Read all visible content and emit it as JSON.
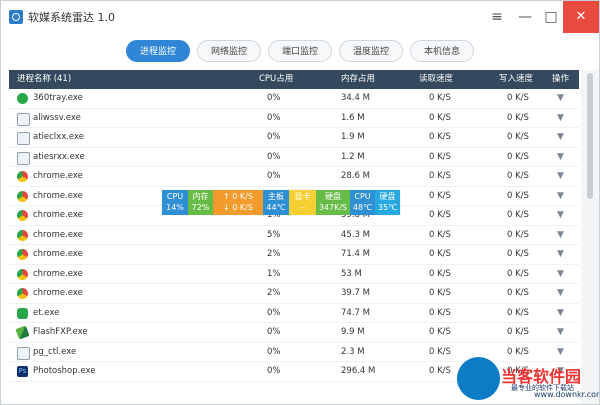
{
  "window": {
    "title": "软媒系统雷达 1.0"
  },
  "controls": {
    "menu": "≡",
    "minimize": "—",
    "maximize": "□",
    "close": "✕"
  },
  "tabs": [
    "进程监控",
    "网络监控",
    "端口监控",
    "温度监控",
    "本机信息"
  ],
  "header": {
    "name": "进程名称 (41)",
    "cpu": "CPU占用",
    "mem": "内存占用",
    "read": "读取速度",
    "write": "写入速度",
    "action": "操作"
  },
  "rows": [
    {
      "name": "360tray.exe",
      "cpu": "0%",
      "mem": "34.4 M",
      "read": "0 K/S",
      "write": "0 K/S",
      "icon": "360-icon"
    },
    {
      "name": "aliwssv.exe",
      "cpu": "0%",
      "mem": "1.6 M",
      "read": "0 K/S",
      "write": "0 K/S",
      "icon": "window-icon"
    },
    {
      "name": "atieclxx.exe",
      "cpu": "0%",
      "mem": "1.9 M",
      "read": "0 K/S",
      "write": "0 K/S",
      "icon": "window-icon"
    },
    {
      "name": "atiesrxx.exe",
      "cpu": "0%",
      "mem": "1.2 M",
      "read": "0 K/S",
      "write": "0 K/S",
      "icon": "window-icon"
    },
    {
      "name": "chrome.exe",
      "cpu": "0%",
      "mem": "28.6 M",
      "read": "0 K/S",
      "write": "0 K/S",
      "icon": "chrome-icon"
    },
    {
      "name": "chrome.exe",
      "cpu": "",
      "mem": "",
      "read": "0 K/S",
      "write": "0 K/S",
      "icon": "chrome-icon"
    },
    {
      "name": "chrome.exe",
      "cpu": "1%",
      "mem": "59.8 M",
      "read": "0 K/S",
      "write": "0 K/S",
      "icon": "chrome-icon"
    },
    {
      "name": "chrome.exe",
      "cpu": "5%",
      "mem": "45.3 M",
      "read": "0 K/S",
      "write": "0 K/S",
      "icon": "chrome-icon"
    },
    {
      "name": "chrome.exe",
      "cpu": "2%",
      "mem": "71.4 M",
      "read": "0 K/S",
      "write": "0 K/S",
      "icon": "chrome-icon"
    },
    {
      "name": "chrome.exe",
      "cpu": "1%",
      "mem": "53 M",
      "read": "0 K/S",
      "write": "0 K/S",
      "icon": "chrome-icon"
    },
    {
      "name": "chrome.exe",
      "cpu": "2%",
      "mem": "39.7 M",
      "read": "0 K/S",
      "write": "0 K/S",
      "icon": "chrome-icon"
    },
    {
      "name": "et.exe",
      "cpu": "0%",
      "mem": "74.7 M",
      "read": "0 K/S",
      "write": "0 K/S",
      "icon": "et-icon"
    },
    {
      "name": "FlashFXP.exe",
      "cpu": "0%",
      "mem": "9.9 M",
      "read": "0 K/S",
      "write": "0 K/S",
      "icon": "flashfxp-icon"
    },
    {
      "name": "pg_ctl.exe",
      "cpu": "0%",
      "mem": "2.3 M",
      "read": "0 K/S",
      "write": "0 K/S",
      "icon": "window-icon"
    },
    {
      "name": "Photoshop.exe",
      "cpu": "0%",
      "mem": "296.4 M",
      "read": "0 K/S",
      "write": "0 K/S",
      "icon": "photoshop-icon"
    }
  ],
  "overlay": {
    "cpu_label": "CPU",
    "cpu_value": "14%",
    "mem_label": "内存",
    "mem_value": "72%",
    "net_up_icon": "↑",
    "net_up_value": "0 K/S",
    "net_down_icon": "↓",
    "net_down_value": "0 K/S",
    "board_label": "主板",
    "board_value": "44℃",
    "gpu_label": "显卡",
    "gpu_value": "--",
    "disk_label": "硬盘",
    "disk_value": "347K/S",
    "cpu_temp_label": "CPU",
    "cpu_temp_value": "48℃",
    "disk_temp_label": "硬盘",
    "disk_temp_value": "35℃"
  },
  "watermark": {
    "title": "当客软件园",
    "subtitle": "最专业的软件下载站",
    "url": "www.downkr.com"
  }
}
